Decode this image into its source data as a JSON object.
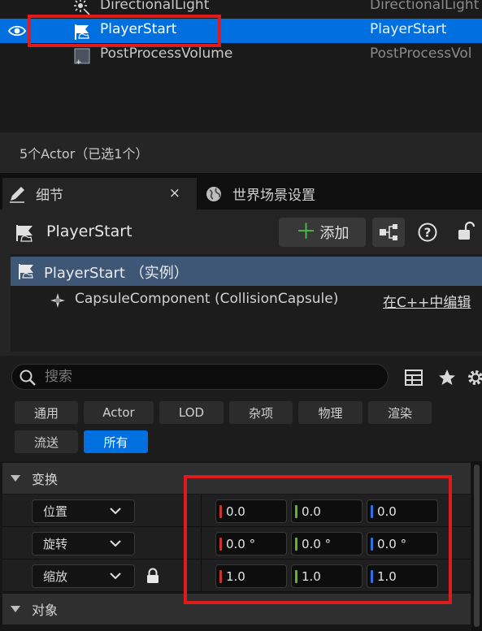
{
  "outliner": {
    "rows": [
      {
        "name": "DirectionalLight",
        "type": "DirectionalLight",
        "icon": "directional-light-icon"
      },
      {
        "name": "PlayerStart",
        "type": "PlayerStart",
        "icon": "player-start-icon",
        "selected": true
      },
      {
        "name": "PostProcessVolume",
        "type": "PostProcessVol",
        "icon": "post-process-volume-icon"
      }
    ],
    "status": "5个Actor（已选1个）"
  },
  "tabs": {
    "details": "细节",
    "close": "×",
    "world_settings": "世界场景设置"
  },
  "details": {
    "actor_name": "PlayerStart",
    "add_label": "添加",
    "add_plus": "＋",
    "tree": {
      "root": "PlayerStart （实例）",
      "child": "CapsuleComponent (CollisionCapsule)",
      "edit_link": "在C++中编辑"
    },
    "search": {
      "placeholder": "搜索",
      "value": ""
    },
    "filters": [
      {
        "label": "通用",
        "active": false
      },
      {
        "label": "Actor",
        "active": false
      },
      {
        "label": "LOD",
        "active": false
      },
      {
        "label": "杂项",
        "active": false
      },
      {
        "label": "物理",
        "active": false
      },
      {
        "label": "渲染",
        "active": false
      },
      {
        "label": "流送",
        "active": false
      },
      {
        "label": "所有",
        "active": true
      }
    ],
    "categories": {
      "transform": "变换",
      "object": "对象"
    },
    "transform": {
      "location": {
        "label": "位置",
        "x": "0.0",
        "y": "0.0",
        "z": "0.0"
      },
      "rotation": {
        "label": "旋转",
        "x": "0.0 °",
        "y": "0.0 °",
        "z": "0.0 °"
      },
      "scale": {
        "label": "缩放",
        "x": "1.0",
        "y": "1.0",
        "z": "1.0"
      }
    }
  },
  "colors": {
    "selection": "#0070e0",
    "highlight_box": "#e01a1a",
    "axis_x": "#c8342c",
    "axis_y": "#5fb52c",
    "axis_z": "#2f6fde"
  }
}
